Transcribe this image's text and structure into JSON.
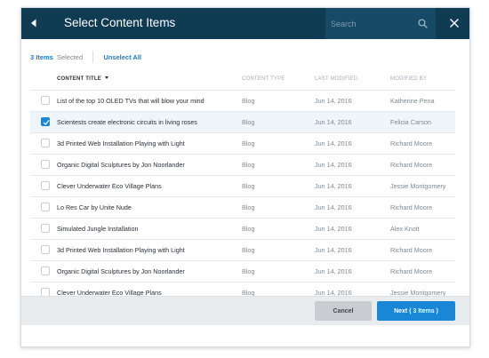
{
  "header": {
    "title": "Select Content Items",
    "search_placeholder": "Search"
  },
  "selection": {
    "count_label": "3 Items",
    "status_label": "Selected",
    "unselect_label": "Unselect All"
  },
  "table": {
    "columns": {
      "title": "Content Title",
      "type": "Content Type",
      "modified": "Last Modified",
      "by": "Modified By"
    },
    "rows": [
      {
        "title": "List of the top 10 OLED TVs that will blow your mind",
        "type": "Blog",
        "modified": "Jun 14, 2016",
        "by": "Katherine Pena",
        "checked": false
      },
      {
        "title": "Scientests create electronic circuits in living roses",
        "type": "Blog",
        "modified": "Jun 14, 2016",
        "by": "Felicia Carson",
        "checked": true
      },
      {
        "title": "3d Printed Web Installation Playing with Light",
        "type": "Blog",
        "modified": "Jun 14, 2016",
        "by": "Richard Moore",
        "checked": false
      },
      {
        "title": "Organic Digital Sculptures by Jon Noorlander",
        "type": "Blog",
        "modified": "Jun 14, 2016",
        "by": "Richard Moore",
        "checked": false
      },
      {
        "title": "Clever Underwater Eco Village Plans",
        "type": "Blog",
        "modified": "Jun 14, 2016",
        "by": "Jessie Montgomery",
        "checked": false
      },
      {
        "title": "Lo Res Car by Unite Nude",
        "type": "Blog",
        "modified": "Jun 14, 2016",
        "by": "Richard Moore",
        "checked": false
      },
      {
        "title": "Simulated Jungle Installation",
        "type": "Blog",
        "modified": "Jun 14, 2016",
        "by": "Alex Knott",
        "checked": false
      },
      {
        "title": "3d Printed Web Installation Playing with Light",
        "type": "Blog",
        "modified": "Jun 14, 2016",
        "by": "Richard Moore",
        "checked": false
      },
      {
        "title": "Organic Digital Sculptures by Jon Noorlander",
        "type": "Blog",
        "modified": "Jun 14, 2016",
        "by": "Richard Moore",
        "checked": false
      },
      {
        "title": "Clever Underwater Eco Village Plans",
        "type": "Blog",
        "modified": "Jun 14, 2016",
        "by": "Jessie Montgomery",
        "checked": false
      }
    ]
  },
  "footer": {
    "cancel_label": "Cancel",
    "next_label": "Next ( 3 Items )"
  },
  "colors": {
    "header_bg": "#0f3b53",
    "accent": "#1a86d6",
    "selected_row_bg": "#eef5fb"
  },
  "icons": {
    "back": "back-arrow-icon",
    "search": "search-icon",
    "close": "close-icon",
    "sort": "sort-caret-icon",
    "check": "checkmark-icon"
  }
}
